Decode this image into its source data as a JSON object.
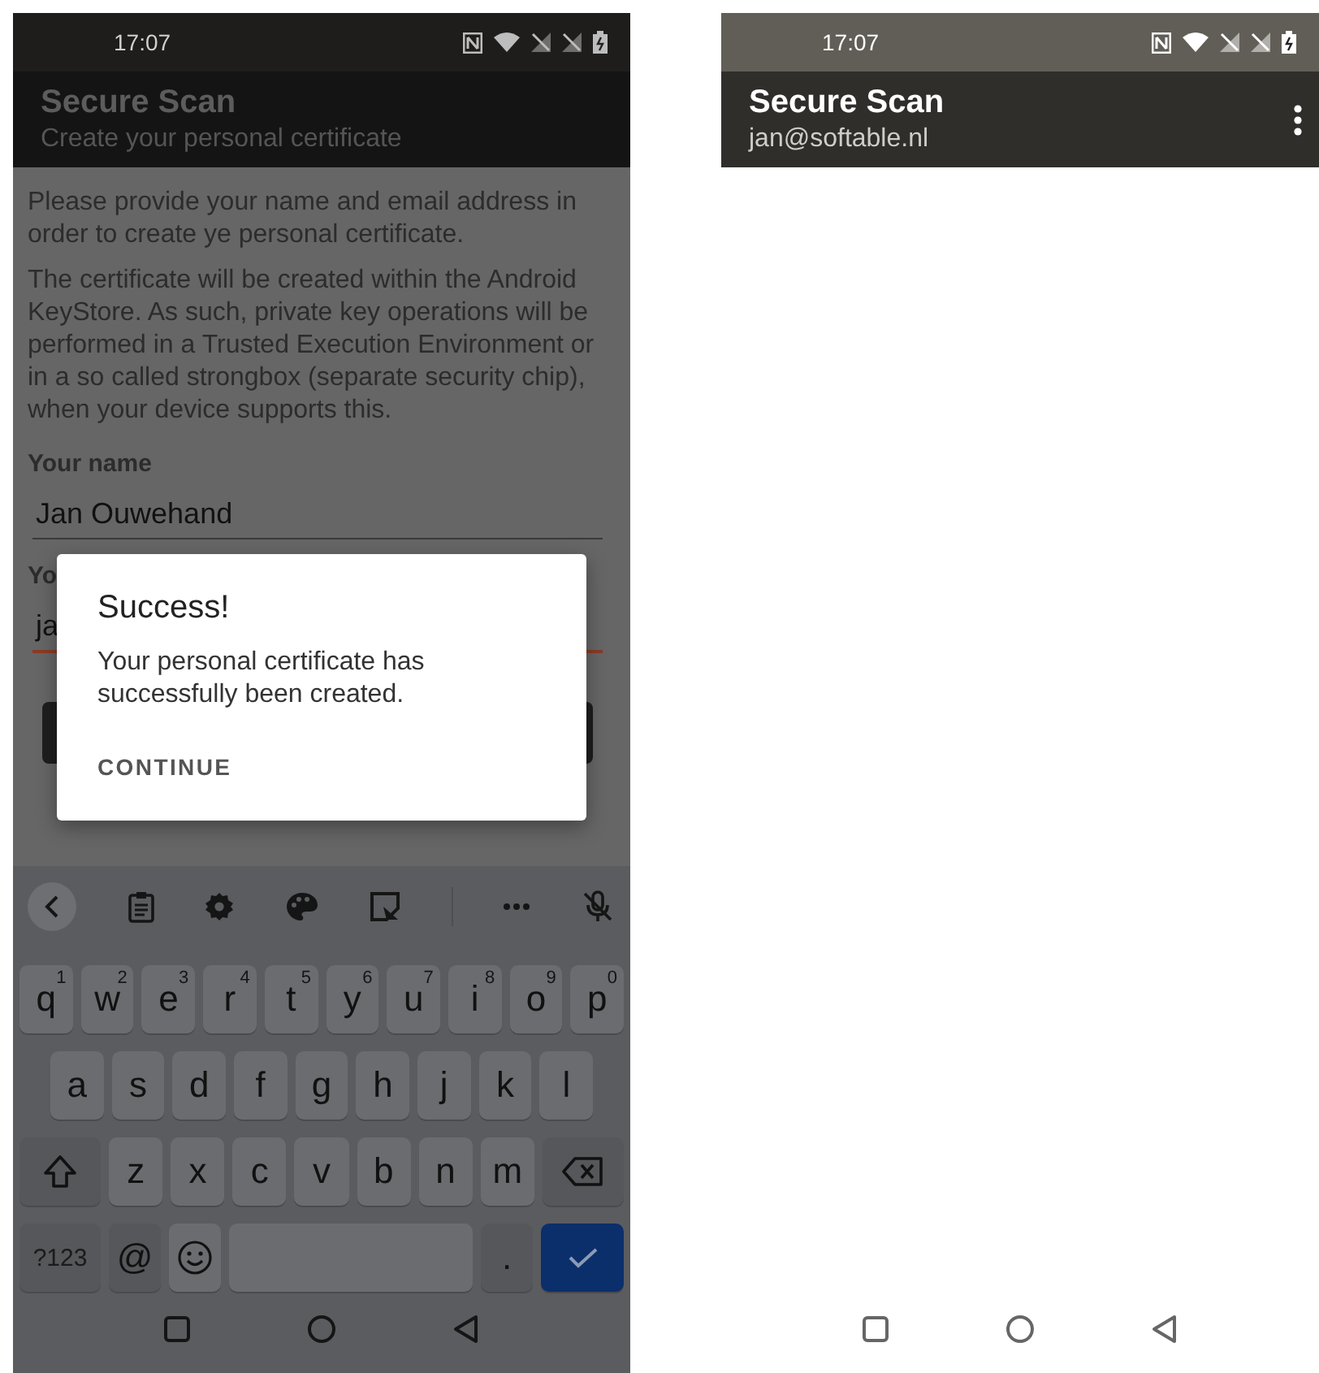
{
  "form_screen": {
    "status_bar": {
      "time": "17:07"
    },
    "app_bar": {
      "title": "Secure Scan",
      "subtitle": "Create your personal certificate"
    },
    "paragraphs": [
      "Please provide your name and email address in order to create ye personal certificate.",
      "The certificate will be created within the Android KeyStore. As such, private key operations will be performed in a Trusted Execution Environment or in a so called strongbox (separate security chip), when your device supports this."
    ],
    "fields": [
      {
        "label": "Your name",
        "value": "Jan Ouwehand",
        "focused": false
      },
      {
        "label": "Yo",
        "value": "ja",
        "focused": true
      }
    ],
    "dialog": {
      "title": "Success!",
      "message": "Your personal certificate has successfully been created.",
      "button": "CONTINUE"
    },
    "keyboard": {
      "rows": [
        [
          {
            "kind": "char",
            "label": "q",
            "hint": "1"
          },
          {
            "kind": "char",
            "label": "w",
            "hint": "2"
          },
          {
            "kind": "char",
            "label": "e",
            "hint": "3"
          },
          {
            "kind": "char",
            "label": "r",
            "hint": "4"
          },
          {
            "kind": "char",
            "label": "t",
            "hint": "5"
          },
          {
            "kind": "char",
            "label": "y",
            "hint": "6"
          },
          {
            "kind": "char",
            "label": "u",
            "hint": "7"
          },
          {
            "kind": "char",
            "label": "i",
            "hint": "8"
          },
          {
            "kind": "char",
            "label": "o",
            "hint": "9"
          },
          {
            "kind": "char",
            "label": "p",
            "hint": "0"
          }
        ],
        [
          {
            "kind": "char",
            "label": "a"
          },
          {
            "kind": "char",
            "label": "s"
          },
          {
            "kind": "char",
            "label": "d"
          },
          {
            "kind": "char",
            "label": "f"
          },
          {
            "kind": "char",
            "label": "g"
          },
          {
            "kind": "char",
            "label": "h"
          },
          {
            "kind": "char",
            "label": "j"
          },
          {
            "kind": "char",
            "label": "k"
          },
          {
            "kind": "char",
            "label": "l"
          }
        ],
        [
          {
            "kind": "shift"
          },
          {
            "kind": "char",
            "label": "z"
          },
          {
            "kind": "char",
            "label": "x"
          },
          {
            "kind": "char",
            "label": "c"
          },
          {
            "kind": "char",
            "label": "v"
          },
          {
            "kind": "char",
            "label": "b"
          },
          {
            "kind": "char",
            "label": "n"
          },
          {
            "kind": "char",
            "label": "m"
          },
          {
            "kind": "backspace"
          }
        ]
      ],
      "bottom_keys": [
        {
          "kind": "symbols",
          "label": "?123"
        },
        {
          "kind": "special",
          "label": "@"
        },
        {
          "kind": "emoji"
        },
        {
          "kind": "space"
        },
        {
          "kind": "special",
          "label": "."
        },
        {
          "kind": "enter"
        }
      ]
    }
  },
  "main_screen": {
    "status_bar": {
      "time": "17:07"
    },
    "app_bar": {
      "title": "Secure Scan",
      "subtitle": "jan@softable.nl"
    }
  }
}
